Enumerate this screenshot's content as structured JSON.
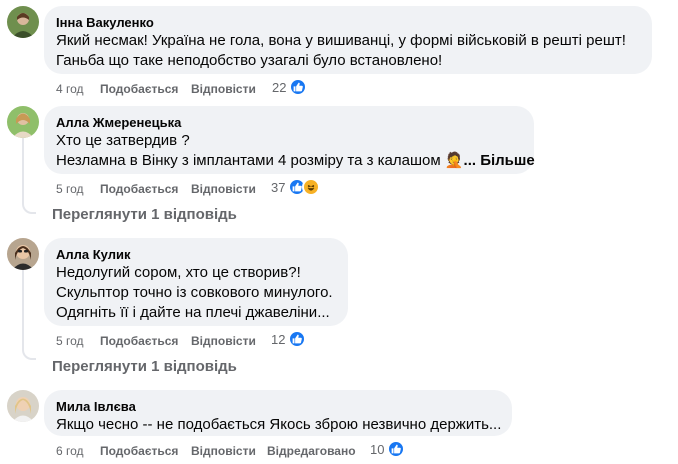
{
  "comments": [
    {
      "author": "Інна Вакуленко",
      "lines": [
        "Який несмак! Україна не гола, вона у вишиванці, у формі військовій в решті решт!",
        "Ганьба що таке неподобство узагалі було встановлено!"
      ],
      "time": "4 год",
      "like_label": "Подобається",
      "reply_label": "Відповісти",
      "reaction_count": "22",
      "reactions": [
        "like"
      ]
    },
    {
      "author": "Алла Жмеренецька",
      "lines": [
        "Хто це затвердив ?",
        "Незламна в Вінку з імплантами 4 розміру та з калашом"
      ],
      "emoji": "🤦",
      "more_label": "... Більше",
      "time": "5 год",
      "like_label": "Подобається",
      "reply_label": "Відповісти",
      "reaction_count": "37",
      "reactions": [
        "like",
        "haha"
      ],
      "view_replies": "Переглянути 1 відповідь"
    },
    {
      "author": "Алла Кулик",
      "lines": [
        "Недолугий сором, хто це створив?!",
        "Скульптор точно із совкового минулого.",
        "Одягніть її і дайте на плечі джавеліни..."
      ],
      "time": "5 год",
      "like_label": "Подобається",
      "reply_label": "Відповісти",
      "reaction_count": "12",
      "reactions": [
        "like"
      ],
      "view_replies": "Переглянути 1 відповідь"
    },
    {
      "author": "Мила Івлєва",
      "lines": [
        "Якщо чесно -- не подобається Якось зброю незвично держить..."
      ],
      "time": "6 год",
      "like_label": "Подобається",
      "reply_label": "Відповісти",
      "edited_label": "Відредаговано",
      "reaction_count": "10",
      "reactions": [
        "like"
      ]
    }
  ],
  "colors": {
    "bubble": "#f0f2f5",
    "meta_text": "#65676b",
    "like_blue": "#1877f2",
    "haha_yellow": "#f7b125"
  },
  "icons": {
    "like": "thumbs-up-icon",
    "haha": "laughing-face-icon"
  }
}
